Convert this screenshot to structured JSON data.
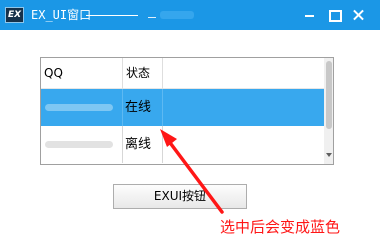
{
  "window": {
    "title": "EX_UI窗口",
    "icon": "EX",
    "title_dash": "_",
    "controls": [
      "minimize-icon",
      "maximize-icon",
      "close-icon"
    ]
  },
  "table": {
    "columns": [
      "QQ",
      "状态"
    ],
    "rows": [
      {
        "qq": "",
        "status": "在线",
        "selected": true
      },
      {
        "qq": "",
        "status": "离线",
        "selected": false
      }
    ]
  },
  "button": {
    "label": "EXUI按钮"
  },
  "annotation": {
    "text": "选中后会变成蓝色",
    "color": "#ff1616"
  },
  "colors": {
    "titlebar": "#1b97e6",
    "selected_row": "#38a8ee",
    "arrow": "#ff1616"
  }
}
